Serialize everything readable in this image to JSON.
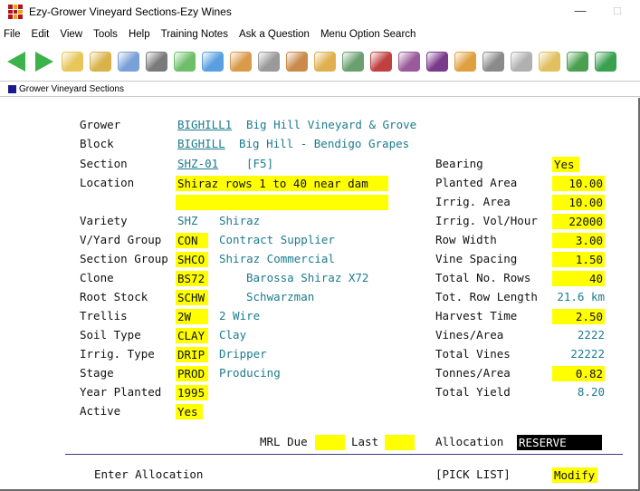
{
  "window": {
    "title": "Ezy-Grower Vineyard Sections-Ezy Wines",
    "minimize": "—",
    "maximize": "□"
  },
  "menu": [
    "File",
    "Edit",
    "View",
    "Tools",
    "Help",
    "Training Notes",
    "Ask a Question",
    "Menu Option Search"
  ],
  "toolbar_icons": [
    {
      "name": "back-arrow-icon",
      "color": "#3cb24a"
    },
    {
      "name": "forward-arrow-icon",
      "color": "#3cb24a"
    },
    {
      "name": "folder-icon",
      "color": "#e8c65a"
    },
    {
      "name": "edit-folder-icon",
      "color": "#d9b24a"
    },
    {
      "name": "pen-icon",
      "color": "#7aa0d8"
    },
    {
      "name": "print-icon",
      "color": "#7a7a7a"
    },
    {
      "name": "money-icon",
      "color": "#6fbf6a"
    },
    {
      "name": "grid-icon",
      "color": "#5aa0e0"
    },
    {
      "name": "people-icon",
      "color": "#d99a4a"
    },
    {
      "name": "wand-icon",
      "color": "#9a9a9a"
    },
    {
      "name": "barrel-icon",
      "color": "#c98a4a"
    },
    {
      "name": "box-icon",
      "color": "#e0b050"
    },
    {
      "name": "bottle-icon",
      "color": "#6aa070"
    },
    {
      "name": "tractor-icon",
      "color": "#c04040"
    },
    {
      "name": "wine-bottle-icon",
      "color": "#9a5a9a"
    },
    {
      "name": "grapes-icon",
      "color": "#7a3a8a"
    },
    {
      "name": "box-stack-icon",
      "color": "#e0a040"
    },
    {
      "name": "gear-icon",
      "color": "#8a8a8a"
    },
    {
      "name": "panel-icon",
      "color": "#b0b0b0"
    },
    {
      "name": "cube-icon",
      "color": "#e0c060"
    },
    {
      "name": "leaf-icon",
      "color": "#4aa050"
    },
    {
      "name": "dollar-icon",
      "color": "#3aa050"
    }
  ],
  "subwindow": {
    "title": "Grower Vineyard Sections"
  },
  "form": {
    "grower": {
      "label": "Grower",
      "code": "BIGHILL1",
      "name": "Big Hill Vineyard & Grove"
    },
    "block": {
      "label": "Block",
      "code": "BIGHILL",
      "name": "Big Hill - Bendigo Grapes"
    },
    "section": {
      "label": "Section",
      "code": "SHZ-01",
      "hint": "[F5]"
    },
    "location": {
      "label": "Location",
      "line1": "Shiraz rows 1 to 40 near dam",
      "line2": ""
    },
    "variety": {
      "label": "Variety",
      "code": "SHZ",
      "name": "Shiraz"
    },
    "vyard_group": {
      "label": "V/Yard Group",
      "code": "CON",
      "name": "Contract Supplier"
    },
    "section_group": {
      "label": "Section Group",
      "code": "SHCO",
      "name": "Shiraz Commercial"
    },
    "clone": {
      "label": "Clone",
      "code": "BS72",
      "name": "Barossa Shiraz X72"
    },
    "root_stock": {
      "label": "Root Stock",
      "code": "SCHW",
      "name": "Schwarzman"
    },
    "trellis": {
      "label": "Trellis",
      "code": "2W",
      "name": "2 Wire"
    },
    "soil_type": {
      "label": "Soil Type",
      "code": "CLAY",
      "name": "Clay"
    },
    "irrig_type": {
      "label": "Irrig. Type",
      "code": "DRIP",
      "name": "Dripper"
    },
    "stage": {
      "label": "Stage",
      "code": "PROD",
      "name": "Producing"
    },
    "year_planted": {
      "label": "Year Planted",
      "value": "1995"
    },
    "active": {
      "label": "Active",
      "value": "Yes"
    },
    "bearing": {
      "label": "Bearing",
      "value": "Yes"
    },
    "planted_area": {
      "label": "Planted Area",
      "value": "10.00"
    },
    "irrig_area": {
      "label": "Irrig. Area",
      "value": "10.00"
    },
    "irrig_vol_hour": {
      "label": "Irrig. Vol/Hour",
      "value": "22000"
    },
    "row_width": {
      "label": "Row Width",
      "value": "3.00"
    },
    "vine_spacing": {
      "label": "Vine Spacing",
      "value": "1.50"
    },
    "total_rows": {
      "label": "Total No. Rows",
      "value": "40"
    },
    "tot_row_length": {
      "label": "Tot. Row Length",
      "value": "21.6 km"
    },
    "harvest_time": {
      "label": "Harvest Time",
      "value": "2.50"
    },
    "vines_area": {
      "label": "Vines/Area",
      "value": "2222"
    },
    "total_vines": {
      "label": "Total Vines",
      "value": "22222"
    },
    "tonnes_area": {
      "label": "Tonnes/Area",
      "value": "0.82"
    },
    "total_yield": {
      "label": "Total Yield",
      "value": "8.20"
    },
    "mrl_due": {
      "label": "MRL Due",
      "value": ""
    },
    "mrl_last": {
      "label": "Last",
      "value": ""
    },
    "allocation": {
      "label": "Allocation",
      "value": "RESERVE"
    }
  },
  "footer": {
    "prompt": "Enter Allocation",
    "pick_list": "[PICK LIST]",
    "mode": "Modify"
  },
  "colors": {
    "highlight": "#ffff00",
    "value_text": "#1c7b8d",
    "focus_field": "#000000"
  }
}
